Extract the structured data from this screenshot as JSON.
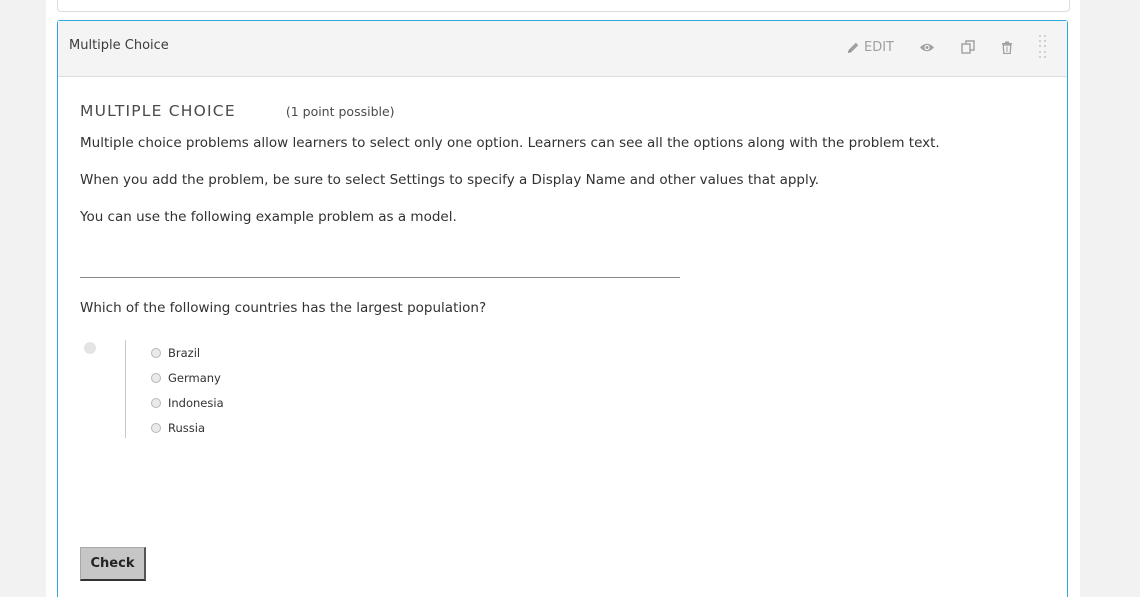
{
  "component": {
    "header_title": "Multiple Choice",
    "actions": {
      "edit_label": "EDIT"
    }
  },
  "problem": {
    "title": "MULTIPLE CHOICE",
    "points": "(1 point possible)",
    "paragraphs": [
      "Multiple choice problems allow learners to select only one option. Learners can see all the options along with the problem text.",
      "When you add the problem, be sure to select Settings to specify a Display Name and other values that apply.",
      "You can use the following example problem as a model."
    ],
    "question": "Which of the following countries has the largest population?",
    "choices": [
      "Brazil",
      "Germany",
      "Indonesia",
      "Russia"
    ],
    "check_label": "Check"
  },
  "icons": {
    "edit": "pencil-icon",
    "preview": "eye-icon",
    "duplicate": "copy-icon",
    "delete": "trash-icon",
    "drag": "drag-handle-icon"
  },
  "colors": {
    "accent_border": "#2ea4dc",
    "header_bg": "#f4f4f4",
    "icon_gray": "#a0a0a0",
    "button_bg": "#c6c6c6"
  }
}
